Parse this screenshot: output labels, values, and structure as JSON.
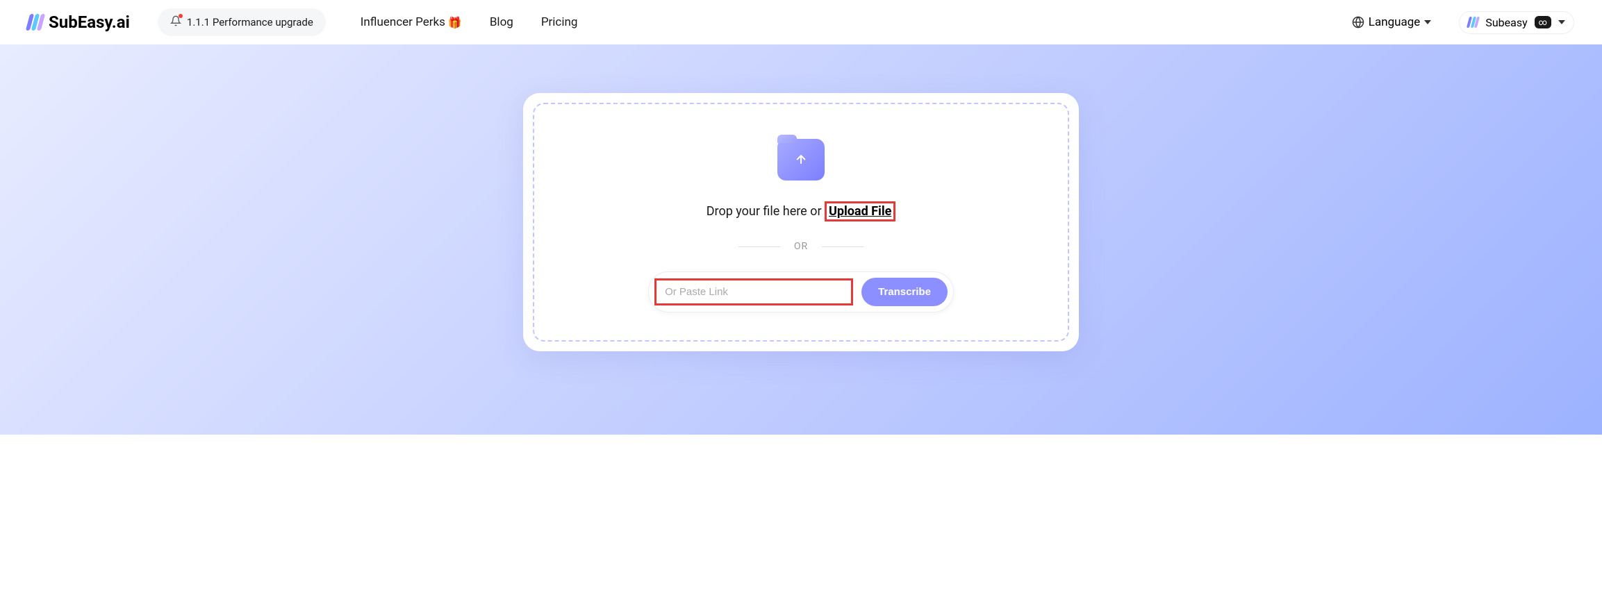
{
  "brand": "SubEasy.ai",
  "pill": {
    "text": "1.1.1 Performance upgrade"
  },
  "nav": {
    "influencer": "Influencer Perks",
    "blog": "Blog",
    "pricing": "Pricing",
    "language": "Language"
  },
  "user": {
    "name": "Subeasy",
    "infinity": "∞"
  },
  "upload": {
    "drop_text": "Drop your file here or ",
    "upload_link": "Upload File",
    "or": "OR",
    "placeholder": "Or Paste Link",
    "transcribe": "Transcribe"
  },
  "gift_emoji": "🎁",
  "colors": {
    "accent": "#8b8fff",
    "highlight": "#e53935"
  }
}
